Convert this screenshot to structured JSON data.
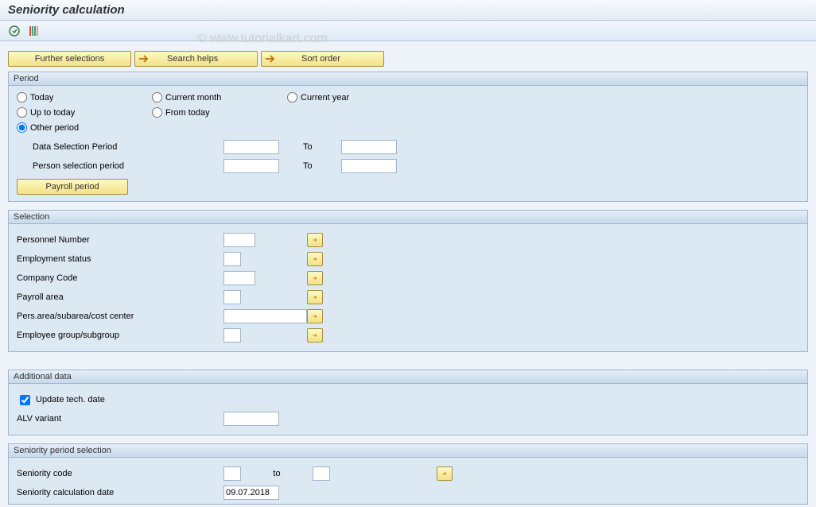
{
  "title": "Seniority calculation",
  "watermark": "© www.tutorialkart.com",
  "top_buttons": {
    "further": "Further selections",
    "search": "Search helps",
    "sort": "Sort order"
  },
  "period": {
    "header": "Period",
    "today": "Today",
    "current_month": "Current month",
    "current_year": "Current year",
    "up_to_today": "Up to today",
    "from_today": "From today",
    "other_period": "Other period",
    "data_sel_period": "Data Selection Period",
    "person_sel_period": "Person selection period",
    "to": "To",
    "payroll_period": "Payroll period",
    "data_from": "",
    "data_to": "",
    "person_from": "",
    "person_to": ""
  },
  "selection": {
    "header": "Selection",
    "personnel_number": "Personnel Number",
    "employment_status": "Employment status",
    "company_code": "Company Code",
    "payroll_area": "Payroll area",
    "pers_area": "Pers.area/subarea/cost center",
    "emp_group": "Employee group/subgroup",
    "v_personnel_number": "",
    "v_employment_status": "",
    "v_company_code": "",
    "v_payroll_area": "",
    "v_pers_area": "",
    "v_emp_group": ""
  },
  "additional": {
    "header": "Additional data",
    "update_tech": "Update tech. date",
    "alv_variant": "ALV variant",
    "v_alv": ""
  },
  "seniority": {
    "header": "Seniority period selection",
    "code": "Seniority code",
    "to": "to",
    "calc_date_label": "Seniority calculation date",
    "v_code_from": "",
    "v_code_to": "",
    "v_calc_date": "09.07.2018"
  }
}
